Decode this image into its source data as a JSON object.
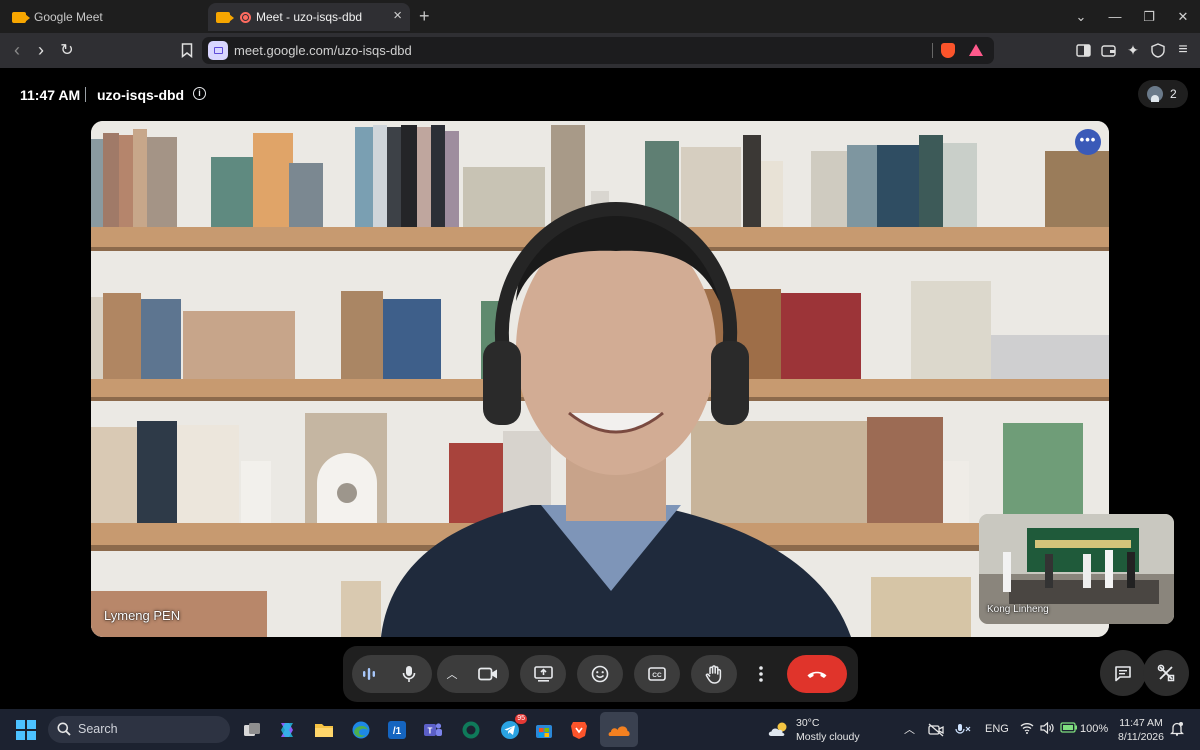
{
  "browser": {
    "tabs": [
      {
        "label": "Google Meet"
      },
      {
        "label": "Meet - uzo-isqs-dbd"
      }
    ],
    "url": "meet.google.com/uzo-isqs-dbd"
  },
  "meet": {
    "time": "11:47 AM",
    "meeting_code": "uzo-isqs-dbd",
    "participant_count": "2",
    "main_participant": "Lymeng PEN",
    "self_participant": "Kong Linheng"
  },
  "controls": {
    "buttons": [
      "sound-levels",
      "microphone",
      "camera-options",
      "camera",
      "present-screen",
      "reactions",
      "captions",
      "raise-hand",
      "more-options",
      "leave-call"
    ],
    "side_buttons": [
      "chat",
      "activities"
    ]
  },
  "taskbar": {
    "search_label": "Search",
    "weather_temp": "30°C",
    "weather_desc": "Mostly cloudy",
    "language": "ENG",
    "battery": "100%",
    "clock_time": "11:47 AM",
    "clock_date": "8/11/2026",
    "telegram_badge": "95"
  },
  "colors": {
    "end_call": "#e0342b",
    "accent_blue": "#3a5ab8",
    "brave_orange": "#fb542b"
  }
}
